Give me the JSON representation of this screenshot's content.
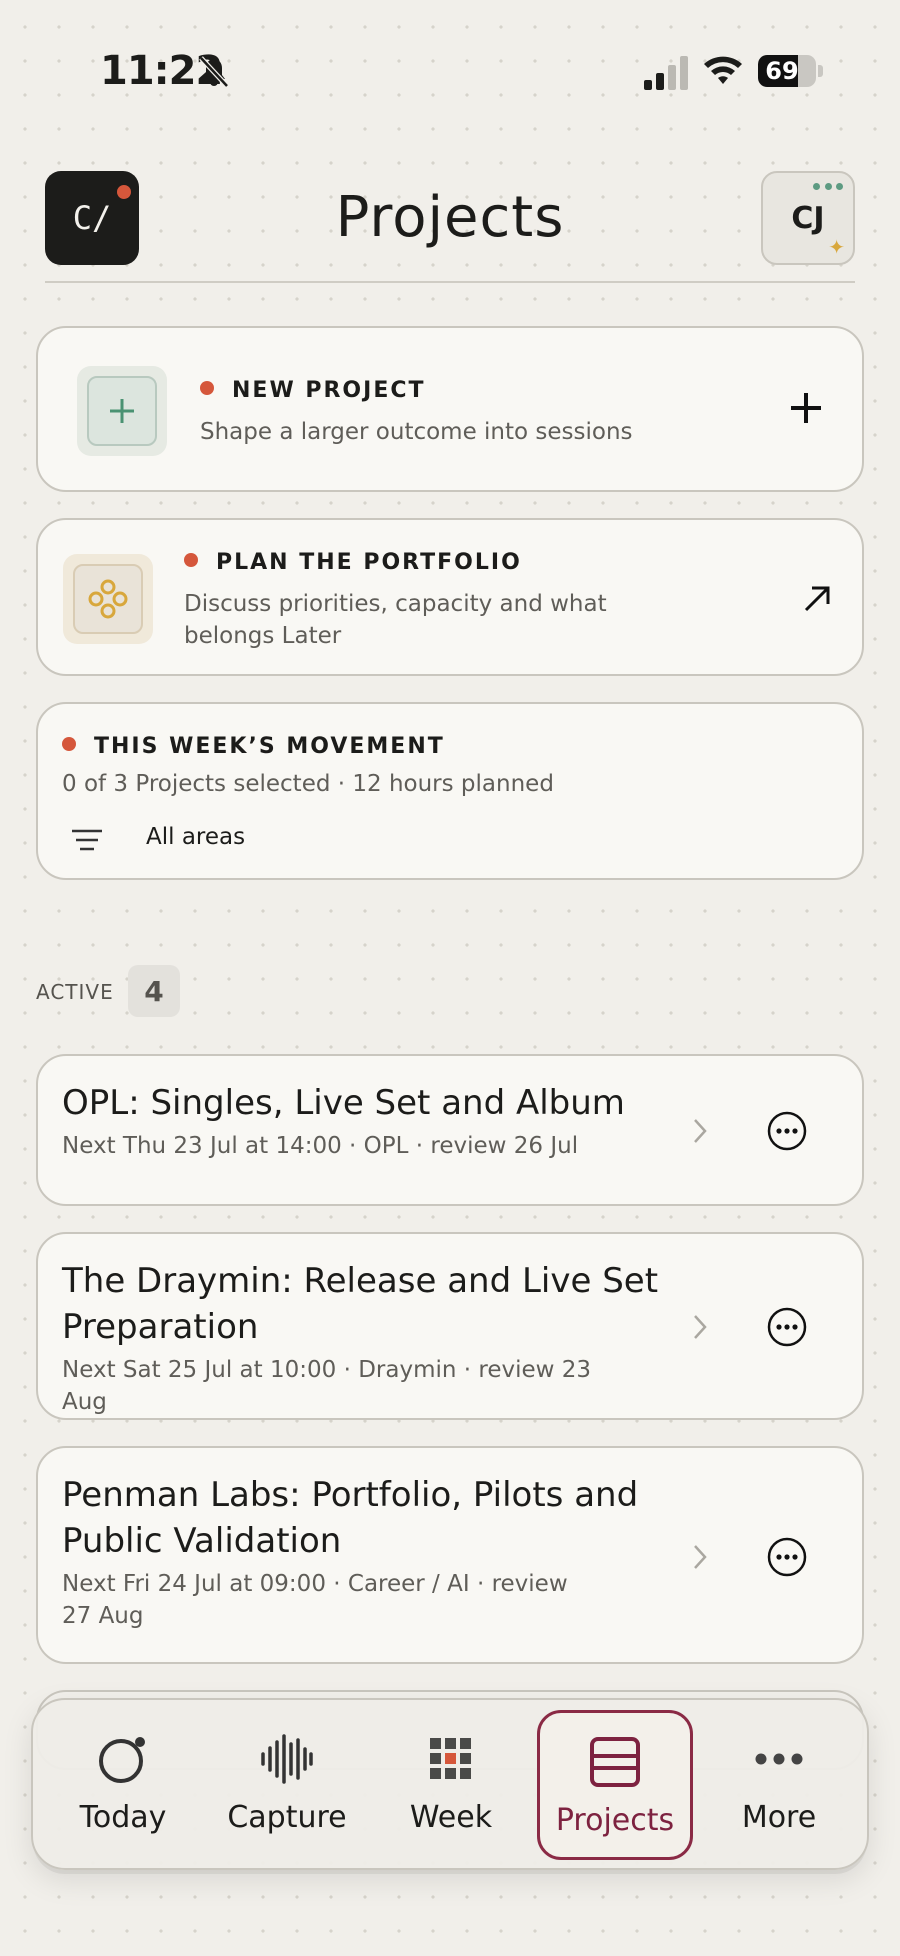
{
  "status_bar": {
    "time": "11:22",
    "battery": "69",
    "battery_level": 0.69
  },
  "header": {
    "logo_text": "C/",
    "title": "Projects",
    "avatar_initials": "CJ"
  },
  "new_project": {
    "title": "NEW PROJECT",
    "subtitle": "Shape a larger outcome into sessions"
  },
  "portfolio": {
    "title": "PLAN THE PORTFOLIO",
    "subtitle": "Discuss priorities, capacity and what belongs Later"
  },
  "movement": {
    "title": "THIS WEEK’S MOVEMENT",
    "subtitle": "0 of 3 Projects selected · 12 hours planned",
    "filter_label": "All areas"
  },
  "section": {
    "label": "ACTIVE",
    "count": "4"
  },
  "projects": [
    {
      "title": "OPL: Singles, Live Set and Album",
      "meta": "Next Thu 23 Jul at 14:00 · OPL · review 26 Jul"
    },
    {
      "title": "The Draymin: Release and Live Set Preparation",
      "meta": "Next Sat 25 Jul at 10:00 · Draymin · review 23 Aug"
    },
    {
      "title": "Penman Labs: Portfolio, Pilots and Public Validation",
      "meta": "Next Fri 24 Jul at 09:00 · Career / AI · review 27 Aug"
    }
  ],
  "tabs": [
    {
      "label": "Today",
      "icon": "circle-dot-icon"
    },
    {
      "label": "Capture",
      "icon": "waveform-icon"
    },
    {
      "label": "Week",
      "icon": "grid-icon"
    },
    {
      "label": "Projects",
      "icon": "projects-icon",
      "active": true
    },
    {
      "label": "More",
      "icon": "ellipsis-icon"
    }
  ],
  "colors": {
    "accent": "#d5573b",
    "active_tab": "#8a2a45",
    "green": "#4a9272",
    "gold": "#d8a73c",
    "background": "#f1efea",
    "card": "#f9f8f4"
  }
}
